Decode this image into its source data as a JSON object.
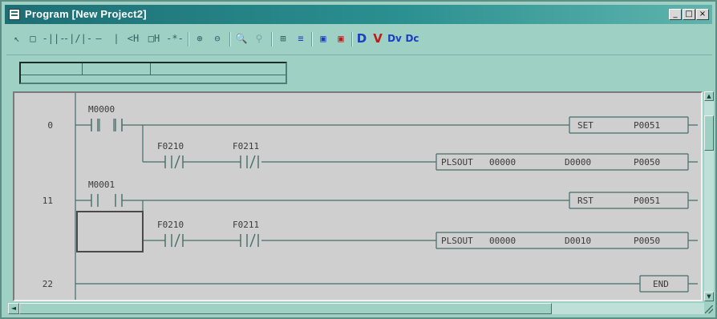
{
  "window": {
    "title": "Program [New Project2]",
    "title_icon": "document-icon",
    "controls": {
      "minimize": "_",
      "maximize": "□",
      "close": "×"
    }
  },
  "toolbar": {
    "tools": [
      {
        "name": "select-tool",
        "icon": "arrow-cursor-icon",
        "glyph": "↖"
      },
      {
        "name": "rectangle-tool",
        "icon": "rectangle-icon",
        "glyph": "□"
      },
      {
        "name": "contact-no-tool",
        "icon": "contact-no-icon",
        "glyph": "-||-"
      },
      {
        "name": "contact-nc-tool",
        "icon": "contact-nc-icon",
        "glyph": "-|/|-"
      },
      {
        "name": "horizontal-line-tool",
        "icon": "horizontal-line-icon",
        "glyph": "—"
      },
      {
        "name": "vertical-line-tool",
        "icon": "vertical-line-icon",
        "glyph": "|"
      },
      {
        "name": "coil-tool",
        "icon": "coil-icon",
        "glyph": "<H"
      },
      {
        "name": "function-tool",
        "icon": "function-block-icon",
        "glyph": "□H"
      },
      {
        "name": "invert-tool",
        "icon": "invert-icon",
        "glyph": "-*-"
      },
      {
        "name": "zoom-in-tool",
        "icon": "zoom-in-icon",
        "glyph": "⊕"
      },
      {
        "name": "zoom-out-tool",
        "icon": "zoom-out-icon",
        "glyph": "⊖"
      },
      {
        "name": "find-tool",
        "icon": "find-icon",
        "glyph": "🔍"
      },
      {
        "name": "find-next-tool",
        "icon": "find-next-icon",
        "glyph": "⚲"
      },
      {
        "name": "zoom-fit-tool",
        "icon": "zoom-fit-icon",
        "glyph": "⊞"
      },
      {
        "name": "list-tool",
        "icon": "list-icon",
        "glyph": "≡"
      },
      {
        "name": "compile-tool",
        "icon": "compile-icon",
        "glyph": "▣"
      },
      {
        "name": "compile-all-tool",
        "icon": "compile-all-icon",
        "glyph": "▣"
      },
      {
        "name": "device-tool",
        "icon": "device-icon",
        "glyph": "D"
      },
      {
        "name": "variable-tool",
        "icon": "variable-icon",
        "glyph": "V"
      },
      {
        "name": "device-variable-tool",
        "icon": "device-variable-icon",
        "glyph": "Dv"
      },
      {
        "name": "device-comment-tool",
        "icon": "device-comment-icon",
        "glyph": "Dc"
      }
    ],
    "colors": {
      "blue": "#1a3fc0",
      "red": "#c01a1a",
      "gray": "#2d6464"
    }
  },
  "ladder": {
    "rungs": [
      {
        "step": "0",
        "contact": "M0000",
        "output": {
          "instr": "SET",
          "operand": "P0051"
        },
        "branch": {
          "contacts": [
            "F0210",
            "F0211"
          ],
          "output": {
            "instr": "PLSOUT",
            "op1": "00000",
            "op2": "D0000",
            "op3": "P0050"
          }
        }
      },
      {
        "step": "11",
        "contact": "M0001",
        "output": {
          "instr": "RST",
          "operand": "P0051"
        },
        "branch": {
          "contacts": [
            "F0210",
            "F0211"
          ],
          "output": {
            "instr": "PLSOUT",
            "op1": "00000",
            "op2": "D0010",
            "op3": "P0050"
          }
        }
      },
      {
        "step": "22",
        "output": {
          "instr": "END"
        }
      }
    ]
  },
  "scrollbars": {
    "left_arrow": "◄",
    "up_arrow": "▲",
    "down_arrow": "▼"
  },
  "colors": {
    "window_bg": "#9ed0c4",
    "title_bg": "#1d6e74",
    "editor_bg": "#cfcfcf",
    "wire": "#466e68"
  }
}
